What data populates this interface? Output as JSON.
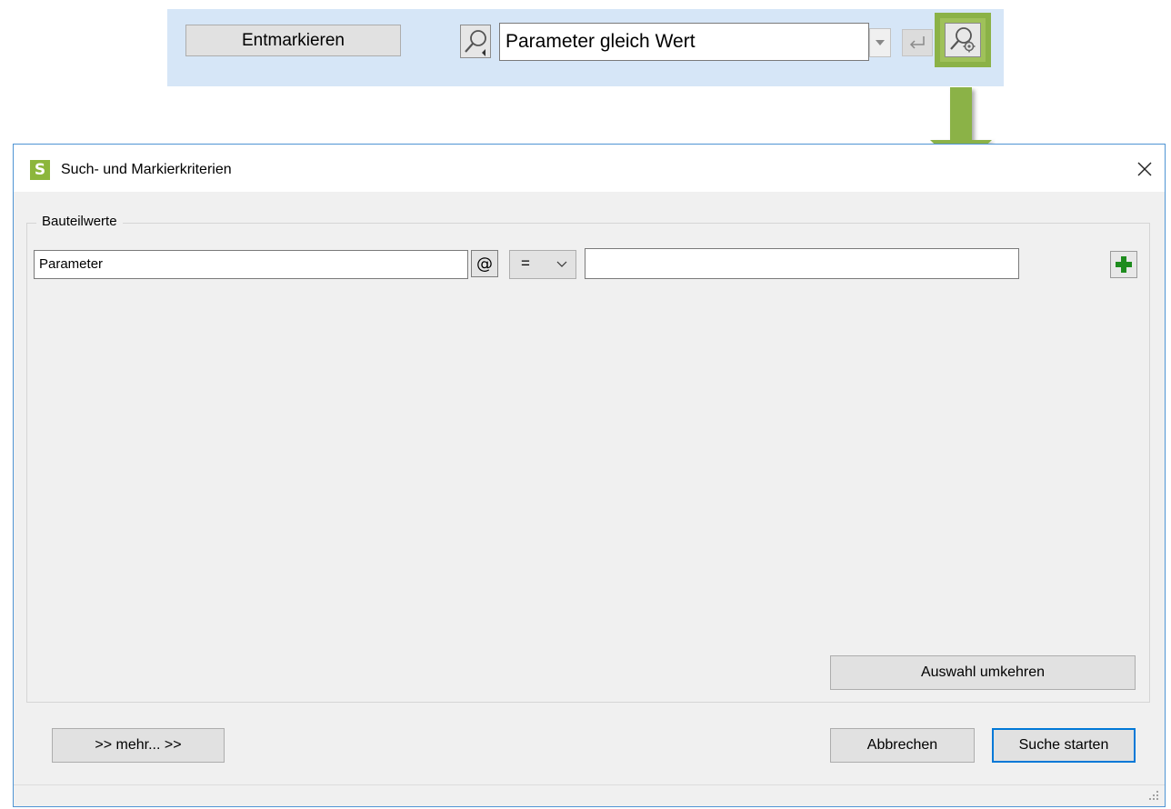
{
  "toolbar": {
    "unmark_label": "Entmarkieren",
    "search_combo_value": "Parameter gleich Wert"
  },
  "dialog": {
    "title": "Such- und Markierkriterien",
    "group_label": "Bauteilwerte",
    "criteria": {
      "parameter_value": "Parameter",
      "at_label": "@",
      "operator": "=",
      "value": ""
    },
    "invert_label": "Auswahl umkehren",
    "more_label": ">>  mehr...  >>",
    "cancel_label": "Abbrechen",
    "start_label": "Suche starten"
  },
  "colors": {
    "toolbar_bg": "#d6e6f7",
    "highlight_green": "#8bb247",
    "logo_green": "#8cb63c",
    "add_green": "#1e8c1e",
    "focus_blue": "#0078d7"
  },
  "icons": {
    "search_mode": "magnifier-with-dropdown-icon",
    "enter": "enter-return-icon",
    "search_settings": "magnifier-gear-icon",
    "add": "plus-icon",
    "close": "close-icon",
    "chevron": "chevron-down-icon"
  }
}
